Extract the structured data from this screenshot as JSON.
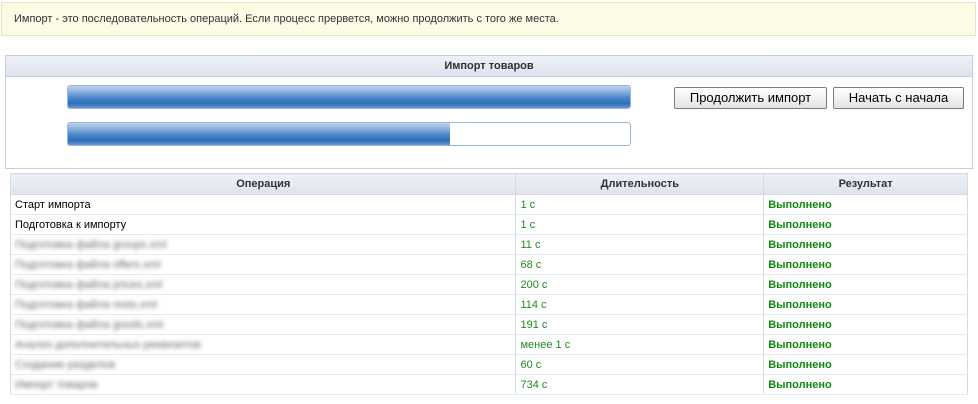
{
  "notice": {
    "text": "Импорт - это последовательность операций. Если процесс прервется, можно продолжить с того же места."
  },
  "panel": {
    "title": "Импорт товаров",
    "progress_primary": 1.0,
    "progress_secondary": 0.68,
    "continue_label": "Продолжить импорт",
    "restart_label": "Начать с начала"
  },
  "table": {
    "headers": {
      "operation": "Операция",
      "duration": "Длительность",
      "result": "Результат"
    },
    "rows": [
      {
        "operation": "Старт импорта",
        "duration": "1 с",
        "result": "Выполнено",
        "obscured": false
      },
      {
        "operation": "Подготовка к импорту",
        "duration": "1 с",
        "result": "Выполнено",
        "obscured": false
      },
      {
        "operation": "Подготовка файла groups.xml",
        "duration": "11 с",
        "result": "Выполнено",
        "obscured": true
      },
      {
        "operation": "Подготовка файла offers.xml",
        "duration": "68 с",
        "result": "Выполнено",
        "obscured": true
      },
      {
        "operation": "Подготовка файла prices.xml",
        "duration": "200 с",
        "result": "Выполнено",
        "obscured": true
      },
      {
        "operation": "Подготовка файла rests.xml",
        "duration": "114 с",
        "result": "Выполнено",
        "obscured": true
      },
      {
        "operation": "Подготовка файла goods.xml",
        "duration": "191 с",
        "result": "Выполнено",
        "obscured": true
      },
      {
        "operation": "Анализ дополнительных реквизитов",
        "duration": "менее 1 с",
        "result": "Выполнено",
        "obscured": true
      },
      {
        "operation": "Создание разделов",
        "duration": "60 с",
        "result": "Выполнено",
        "obscured": true
      },
      {
        "operation": "Импорт товаров",
        "duration": "734 с",
        "result": "Выполнено",
        "obscured": true
      }
    ]
  },
  "colors": {
    "progress_blue": "#3a78c2",
    "result_green": "#0e8a0e",
    "notice_bg": "#fcfbe5"
  }
}
